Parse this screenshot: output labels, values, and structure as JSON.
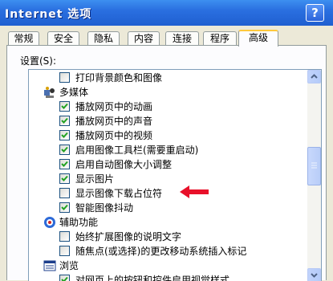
{
  "window": {
    "title": "Internet 选项",
    "help_label": "?"
  },
  "tabs": [
    {
      "label": "常规"
    },
    {
      "label": "安全"
    },
    {
      "label": "隐私"
    },
    {
      "label": "内容"
    },
    {
      "label": "连接"
    },
    {
      "label": "程序"
    },
    {
      "label": "高级",
      "active": true
    }
  ],
  "settings": {
    "label": "设置(S):"
  },
  "list": {
    "items": [
      {
        "type": "checkbox",
        "label": "打印背景颜色和图像",
        "checked": false
      },
      {
        "type": "category",
        "label": "多媒体",
        "icon": "multimedia-icon"
      },
      {
        "type": "checkbox",
        "label": "播放网页中的动画",
        "checked": true
      },
      {
        "type": "checkbox",
        "label": "播放网页中的声音",
        "checked": true
      },
      {
        "type": "checkbox",
        "label": "播放网页中的视频",
        "checked": true
      },
      {
        "type": "checkbox",
        "label": "启用图像工具栏(需要重启动)",
        "checked": true
      },
      {
        "type": "checkbox",
        "label": "启用自动图像大小调整",
        "checked": true
      },
      {
        "type": "checkbox",
        "label": "显示图片",
        "checked": true
      },
      {
        "type": "checkbox",
        "label": "显示图像下载占位符",
        "checked": false
      },
      {
        "type": "checkbox",
        "label": "智能图像抖动",
        "checked": true
      },
      {
        "type": "category",
        "label": "辅助功能",
        "icon": "accessibility-icon"
      },
      {
        "type": "checkbox",
        "label": "始终扩展图像的说明文字",
        "checked": false
      },
      {
        "type": "checkbox",
        "label": "随焦点(或选择)的更改移动系统插入标记",
        "checked": false
      },
      {
        "type": "category",
        "label": "浏览",
        "icon": "browsing-icon"
      },
      {
        "type": "checkbox",
        "label": "对网页上的按钮和控件启用视觉样式",
        "checked": true
      }
    ]
  },
  "colors": {
    "title_bar": "#2a6fe0",
    "active_tab_accent": "#ffc83c",
    "checkmark": "#21a121",
    "annotation_arrow": "#e8102a"
  }
}
